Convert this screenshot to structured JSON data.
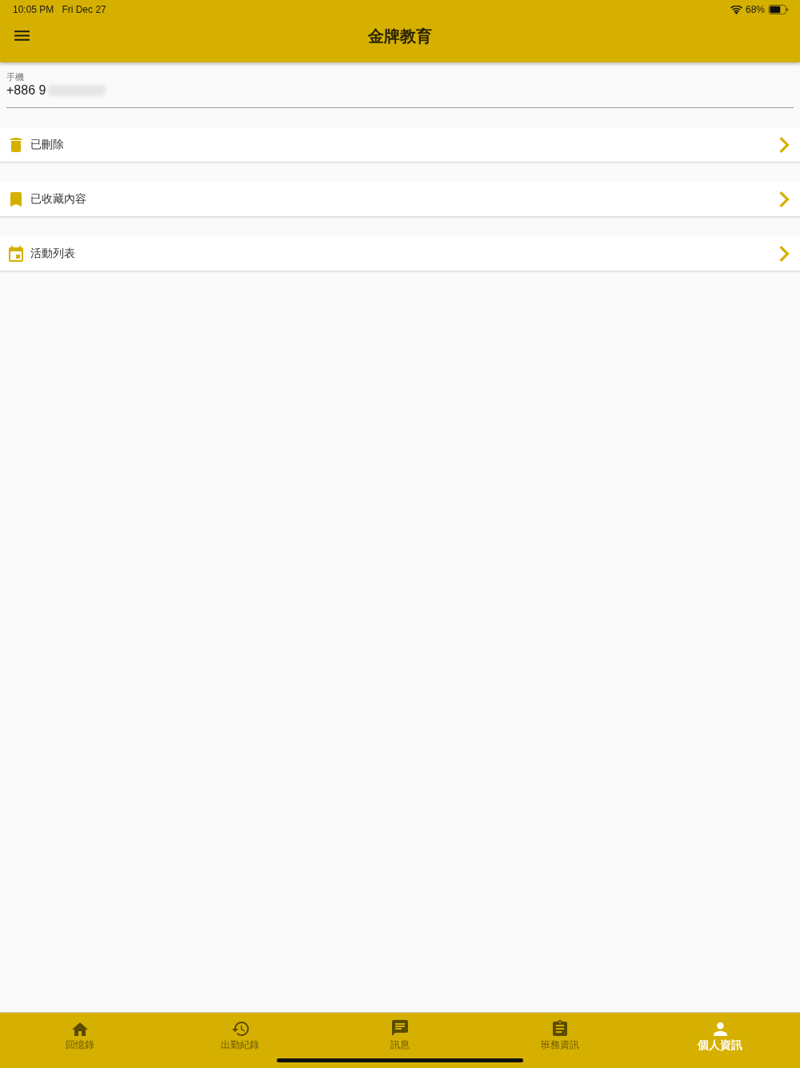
{
  "status_bar": {
    "time": "10:05 PM",
    "date": "Fri Dec 27",
    "battery": "68%"
  },
  "header": {
    "title": "金牌教育"
  },
  "phone_field": {
    "label": "手機",
    "value": "+886 9"
  },
  "menu_items": [
    {
      "kind": "trash",
      "label": "已刪除"
    },
    {
      "kind": "bookmark",
      "label": "已收藏內容"
    },
    {
      "kind": "calendar",
      "label": "活動列表"
    }
  ],
  "tab_bar": [
    {
      "kind": "home",
      "label": "回憶錄",
      "selected": false
    },
    {
      "kind": "history",
      "label": "出勤紀錄",
      "selected": false
    },
    {
      "kind": "chat",
      "label": "訊息",
      "selected": false
    },
    {
      "kind": "clipboard",
      "label": "班務資訊",
      "selected": false
    },
    {
      "kind": "person",
      "label": "個人資訊",
      "selected": true
    }
  ]
}
